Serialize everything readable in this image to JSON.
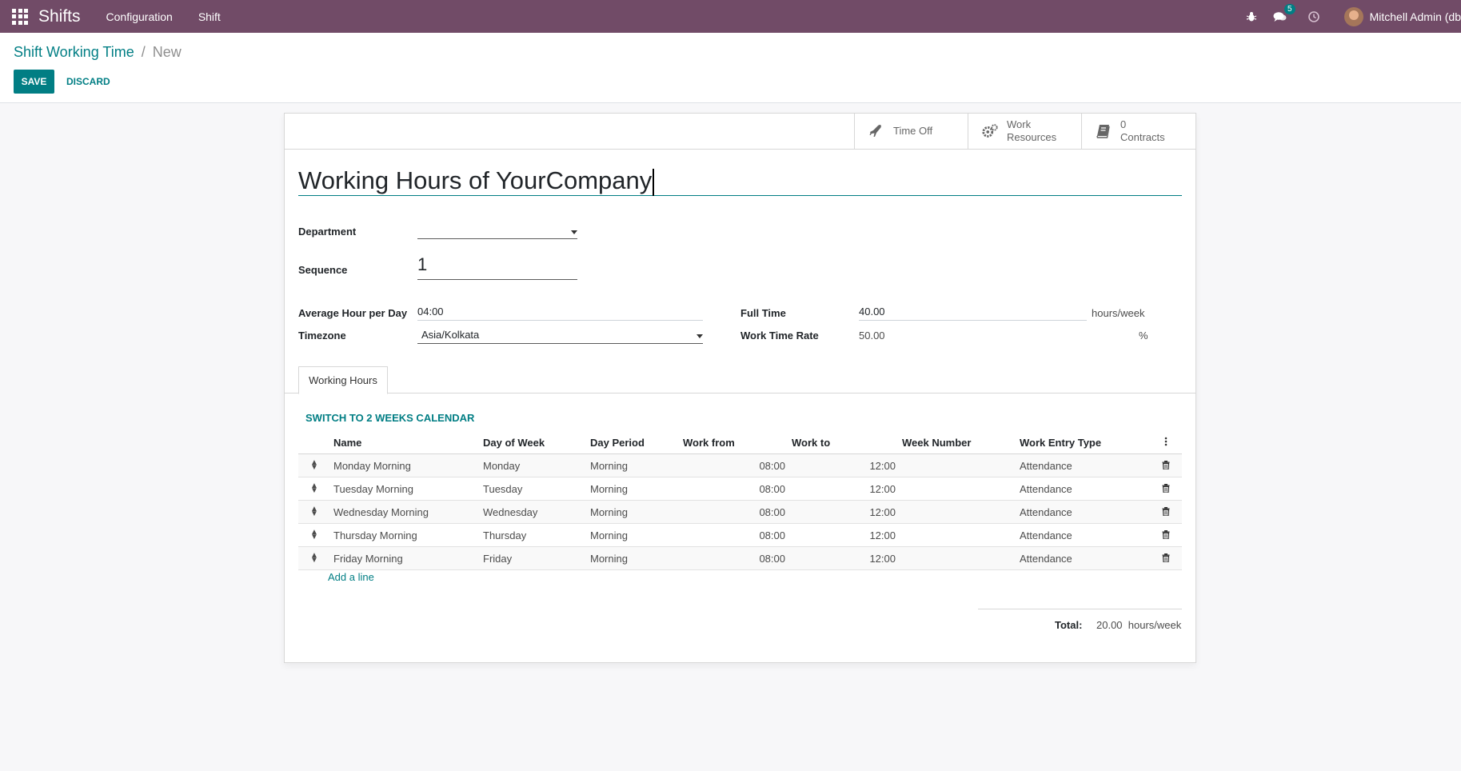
{
  "navbar": {
    "brand": "Shifts",
    "menu": [
      "Configuration",
      "Shift"
    ],
    "messages_badge": "5",
    "user_name": "Mitchell Admin (db"
  },
  "breadcrumb": {
    "parent": "Shift Working Time",
    "separator": "/",
    "current": "New"
  },
  "actions": {
    "save": "SAVE",
    "discard": "DISCARD"
  },
  "stat_buttons": {
    "time_off": "Time Off",
    "work_resources_line1": "Work",
    "work_resources_line2": "Resources",
    "contracts_count": "0",
    "contracts_label": "Contracts"
  },
  "form": {
    "name": "Working Hours of YourCompany",
    "department_label": "Department",
    "department_value": "",
    "sequence_label": "Sequence",
    "sequence_value": "1",
    "avg_hour_label": "Average Hour per Day",
    "avg_hour_value": "04:00",
    "timezone_label": "Timezone",
    "timezone_value": "Asia/Kolkata",
    "full_time_label": "Full Time",
    "full_time_value": "40.00",
    "full_time_unit": "hours/week",
    "work_time_rate_label": "Work Time Rate",
    "work_time_rate_value": "50.00",
    "work_time_rate_unit": "%"
  },
  "notebook": {
    "tab": "Working Hours",
    "switch_link": "SWITCH TO 2 WEEKS CALENDAR",
    "columns": [
      "Name",
      "Day of Week",
      "Day Period",
      "Work from",
      "Work to",
      "Week Number",
      "Work Entry Type"
    ],
    "rows": [
      {
        "name": "Monday Morning",
        "day": "Monday",
        "period": "Morning",
        "from": "08:00",
        "to": "12:00",
        "week": "",
        "type": "Attendance"
      },
      {
        "name": "Tuesday Morning",
        "day": "Tuesday",
        "period": "Morning",
        "from": "08:00",
        "to": "12:00",
        "week": "",
        "type": "Attendance"
      },
      {
        "name": "Wednesday Morning",
        "day": "Wednesday",
        "period": "Morning",
        "from": "08:00",
        "to": "12:00",
        "week": "",
        "type": "Attendance"
      },
      {
        "name": "Thursday Morning",
        "day": "Thursday",
        "period": "Morning",
        "from": "08:00",
        "to": "12:00",
        "week": "",
        "type": "Attendance"
      },
      {
        "name": "Friday Morning",
        "day": "Friday",
        "period": "Morning",
        "from": "08:00",
        "to": "12:00",
        "week": "",
        "type": "Attendance"
      }
    ],
    "add_line": "Add a line",
    "total_label": "Total:",
    "total_value": "20.00  hours/week"
  }
}
